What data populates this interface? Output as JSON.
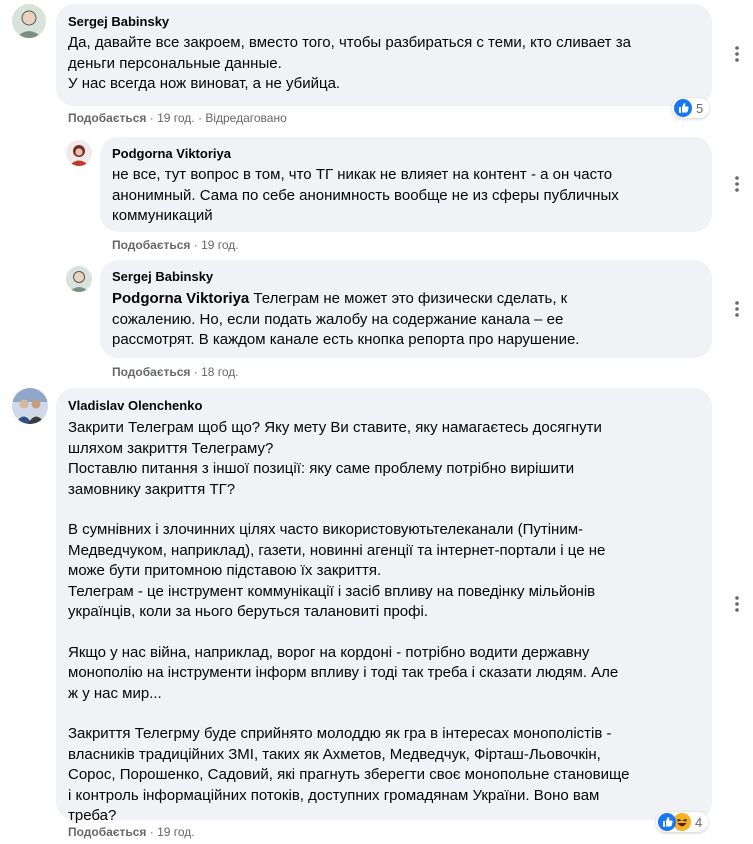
{
  "comments": [
    {
      "author": "Sergej Babinsky",
      "lines": [
        "Да, давайте все закроем, вместо того, чтобы разбираться с теми, кто сливает за",
        "деньги персональные данные.",
        "У нас всегда нож виноват, а не убийца."
      ],
      "like_label": "Подобається",
      "time": "19 год.",
      "edited": "Відредаговано",
      "reaction_count": "5"
    },
    {
      "author": "Podgorna Viktoriya",
      "lines": [
        "не все, тут вопрос в том, что ТГ никак не влияет на контент - а он часто",
        "анонимный. Сама по себе анонимность вообще не из сферы публичных",
        "коммуникаций"
      ],
      "like_label": "Подобається",
      "time": "19 год."
    },
    {
      "author": "Sergej Babinsky",
      "mention": "Podgorna Viktoriya",
      "first_line_rest": " Телеграм не может это физически сделать, к",
      "lines": [
        "сожалению. Но, если подать жалобу на содержание канала – ее",
        "рассмотрят. В каждом канале есть кнопка репорта про нарушение."
      ],
      "like_label": "Подобається",
      "time": "18 год."
    },
    {
      "author": "Vladislav Olenchenko",
      "paragraphs": [
        [
          "Закрити Телеграм щоб що? Яку мету Ви ставите, яку намагаєтесь досягнути",
          "шляхом закриття Телеграму?",
          "Поставлю питання з іншої позиції: яку саме проблему потрібно вирішити",
          "замовнику закриття ТГ?"
        ],
        [
          "В сумнівних і злочинних цілях часто використовуютьтелеканали (Путіним-",
          "Медведчуком, наприклад), газети, новинні агенції та інтернет-портали і це не",
          "може бути притомною підставою їх закриття.",
          "Телеграм - це інструмент коммунікації і засіб впливу на поведінку мільйонів",
          "українців, коли за нього беруться талановиті профі."
        ],
        [
          "Якщо у нас війна, наприклад, ворог на кордоні - потрібно водити державну",
          "монополію на інструменти інформ впливу і тоді так треба і сказати людям. Але",
          "ж у нас мир..."
        ],
        [
          "Закриття Телегрму буде сприйнято молоддю як гра в інтересах монополістів -",
          "власників традиційних ЗМІ, таких як Ахметов, Медведчук, Фірташ-Льовочкін,",
          "Сорос, Порошенко, Садовий, які прагнуть зберегти своє монопольне становище",
          "і контроль інформаційних потоків, доступних громадянам України. Воно вам",
          "треба?"
        ]
      ],
      "like_label": "Подобається",
      "time": "19 год.",
      "reaction_count": "4"
    }
  ],
  "separator": "·",
  "colors": {
    "bubble": "#f0f2f5",
    "meta": "#65676b",
    "like_blue": "#1877f2",
    "haha_yellow": "#f7b125"
  },
  "icons": {
    "like": "thumbs-up-icon",
    "haha": "laughing-face-icon"
  }
}
